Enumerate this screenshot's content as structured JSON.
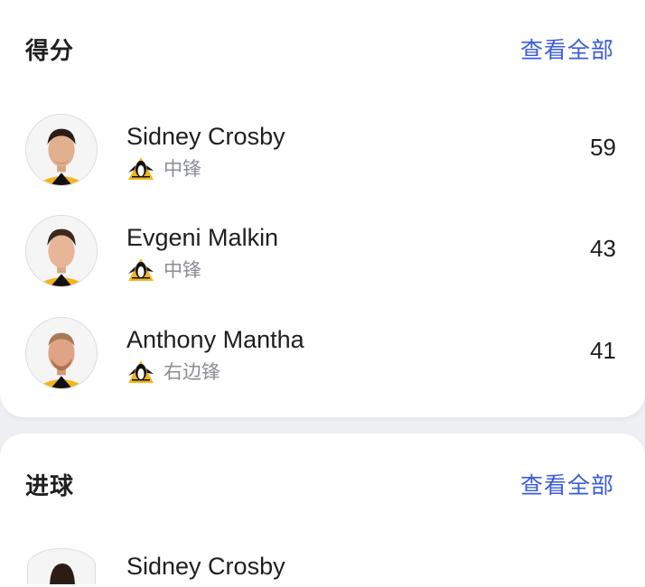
{
  "sections": [
    {
      "title": "得分",
      "see_all_label": "查看全部",
      "players": [
        {
          "name": "Sidney Crosby",
          "position": "中锋",
          "value": "59",
          "team_icon": "penguins-logo-icon"
        },
        {
          "name": "Evgeni Malkin",
          "position": "中锋",
          "value": "43",
          "team_icon": "penguins-logo-icon"
        },
        {
          "name": "Anthony Mantha",
          "position": "右边锋",
          "value": "41",
          "team_icon": "penguins-logo-icon"
        }
      ]
    },
    {
      "title": "进球",
      "see_all_label": "查看全部",
      "players": [
        {
          "name": "Sidney Crosby"
        }
      ]
    }
  ],
  "colors": {
    "accent": "#3b5bdb",
    "secondary_text": "#8a8d93",
    "card_bg": "#ffffff",
    "page_bg": "#eef0f3"
  }
}
